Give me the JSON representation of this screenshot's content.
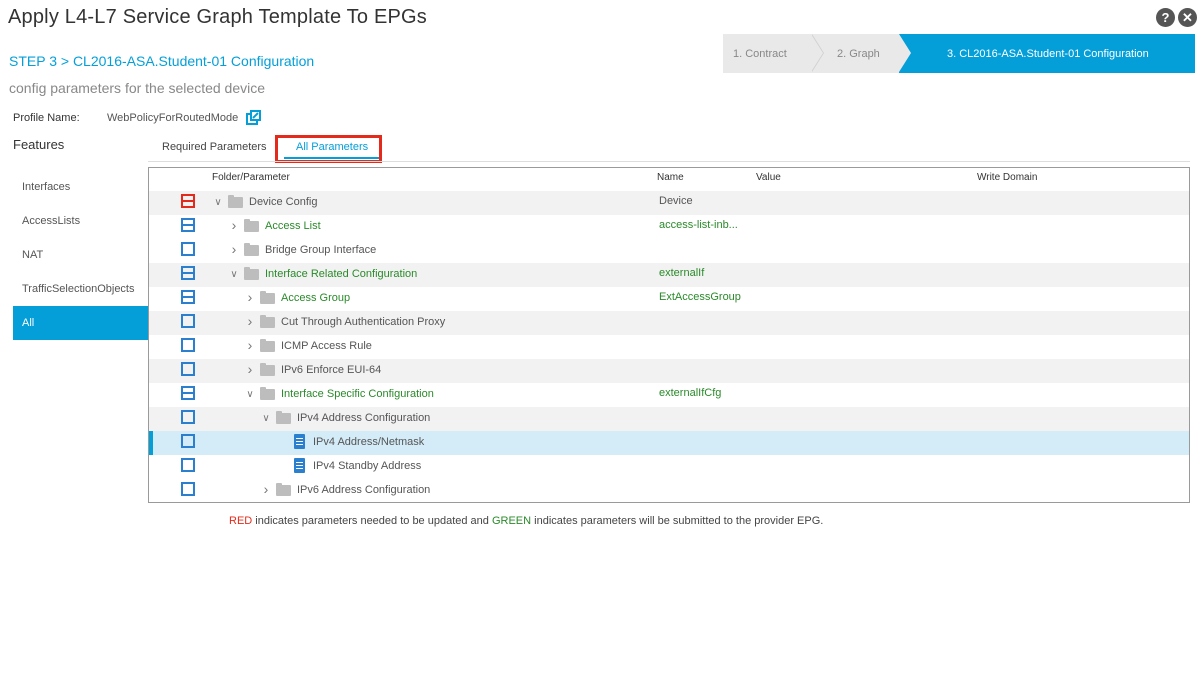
{
  "window": {
    "title": "Apply L4-L7 Service Graph Template To EPGs",
    "help_glyph": "?",
    "close_glyph": "✕"
  },
  "step": {
    "title": "STEP 3 > CL2016-ASA.Student-01 Configuration",
    "subtitle": "config parameters for the selected device"
  },
  "wizard": {
    "steps": [
      "1. Contract",
      "2. Graph",
      "3. CL2016-ASA.Student-01 Configuration"
    ],
    "active_index": 2
  },
  "profile": {
    "label": "Profile Name:",
    "value": "WebPolicyForRoutedMode"
  },
  "features": {
    "heading": "Features",
    "items": [
      "Interfaces",
      "AccessLists",
      "NAT",
      "TrafficSelectionObjects",
      "All"
    ],
    "active_index": 4
  },
  "tabs": {
    "required": "Required Parameters",
    "all": "All Parameters",
    "active": "all"
  },
  "grid": {
    "columns": {
      "folder": "Folder/Parameter",
      "name": "Name",
      "value": "Value",
      "write_domain": "Write Domain"
    },
    "rows": [
      {
        "label": "Device Config",
        "name": "Device",
        "check": "partial-red",
        "caret": "open",
        "icon": "folder",
        "level": 0,
        "status": "normal",
        "shaded": true
      },
      {
        "label": "Access List",
        "name": "access-list-inb...",
        "check": "partial",
        "caret": "closed",
        "icon": "folder",
        "level": 1,
        "status": "green",
        "shaded": false
      },
      {
        "label": "Bridge Group Interface",
        "name": "",
        "check": "empty",
        "caret": "closed",
        "icon": "folder",
        "level": 1,
        "status": "normal",
        "shaded": false
      },
      {
        "label": "Interface Related Configuration",
        "name": "externalIf",
        "check": "partial",
        "caret": "open",
        "icon": "folder",
        "level": 1,
        "status": "green",
        "shaded": true
      },
      {
        "label": "Access Group",
        "name": "ExtAccessGroup",
        "check": "partial",
        "caret": "closed",
        "icon": "folder",
        "level": 2,
        "status": "green",
        "shaded": false
      },
      {
        "label": "Cut Through Authentication Proxy",
        "name": "",
        "check": "empty",
        "caret": "closed",
        "icon": "folder",
        "level": 2,
        "status": "normal",
        "shaded": true
      },
      {
        "label": "ICMP Access Rule",
        "name": "",
        "check": "empty",
        "caret": "closed",
        "icon": "folder",
        "level": 2,
        "status": "normal",
        "shaded": false
      },
      {
        "label": "IPv6 Enforce EUI-64",
        "name": "",
        "check": "empty",
        "caret": "closed",
        "icon": "folder",
        "level": 2,
        "status": "normal",
        "shaded": true
      },
      {
        "label": "Interface Specific Configuration",
        "name": "externalIfCfg",
        "check": "partial",
        "caret": "open",
        "icon": "folder",
        "level": 2,
        "status": "green",
        "shaded": false
      },
      {
        "label": "IPv4 Address Configuration",
        "name": "",
        "check": "empty",
        "caret": "open",
        "icon": "folder",
        "level": 3,
        "status": "normal",
        "shaded": true
      },
      {
        "label": "IPv4 Address/Netmask",
        "name": "",
        "check": "empty",
        "caret": "none",
        "icon": "param",
        "level": 4,
        "status": "normal",
        "shaded": false,
        "selected": true
      },
      {
        "label": "IPv4 Standby Address",
        "name": "",
        "check": "empty",
        "caret": "none",
        "icon": "param",
        "level": 4,
        "status": "normal",
        "shaded": false
      },
      {
        "label": "IPv6 Address Configuration",
        "name": "",
        "check": "empty",
        "caret": "closed",
        "icon": "folder",
        "level": 3,
        "status": "normal",
        "shaded": false
      }
    ]
  },
  "legend": {
    "red_word": "RED",
    "middle": " indicates parameters needed to be updated and ",
    "green_word": "GREEN",
    "end": " indicates parameters will be submitted to the provider EPG."
  },
  "colors": {
    "accent": "#049fd9",
    "green": "#2a8a2a",
    "red": "#e42b1b"
  }
}
